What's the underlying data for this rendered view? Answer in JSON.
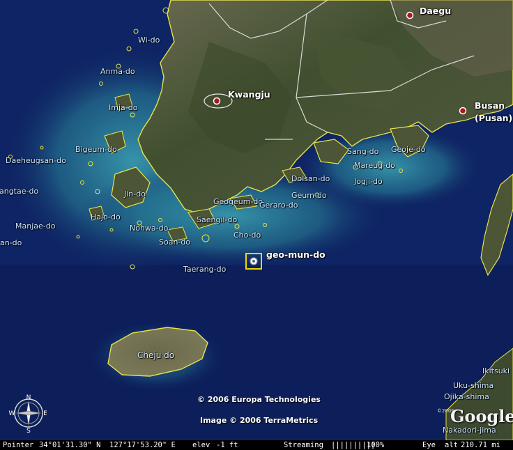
{
  "placemark": {
    "label": "geo-mun-do"
  },
  "cities": {
    "daegu": "Daegu",
    "kwangju": "Kwangju",
    "busan": "Busan",
    "pusan": "(Pusan)"
  },
  "islands": {
    "wi_do": "Wi-do",
    "anma_do": "Anma-do",
    "imja_do": "Imja-do",
    "bigeum_do": "Bigeum-do",
    "daeheugsan_do": "Daeheugsan-do",
    "sangtae_do": "Sangtae-do",
    "jin_do": "Jin-do",
    "hajo_do": "Hajo-do",
    "manjae_do": "Manjae-do",
    "an_do": "an-do",
    "nohwa_do": "Nohwa-do",
    "soan_do": "Soan-do",
    "saengil_do": "Saengil-do",
    "geogeum_do": "Geogeum-do",
    "geraro_do": "Geraro-do",
    "cho_do": "Cho-do",
    "geum_do": "Geum-do",
    "dolsan_do": "Dolsan-do",
    "sang_do": "Sang-do",
    "geoje_do": "Geoje-do",
    "mareug_do": "Mareug-do",
    "jogji_do": "Jogji-do",
    "taerang_do": "Taerang-do",
    "cheju_do": "Cheju do",
    "ikitsuki": "Ikitsuki",
    "uku_shima": "Uku-shima",
    "ojika_shima": "Ojika-shima",
    "nakadori_jima": "Nakadori-jima"
  },
  "credits": {
    "europa": "© 2006 Europa Technologies",
    "terrametrics": "Image © 2006 TerraMetrics",
    "logo": "Google",
    "logo_small": "©2006"
  },
  "status_bar": {
    "pointer_label": "Pointer",
    "pointer_lat": "34°01'31.30\" N",
    "pointer_lon": "127°17'53.20\" E",
    "elev_label": "elev",
    "elev_value": "-1 ft",
    "streaming_label": "Streaming",
    "streaming_bars": "||||||||||",
    "streaming_percent": "100%",
    "eye_label": "Eye",
    "alt_label": "alt",
    "alt_value": "210.71 mi"
  },
  "compass": {
    "n": "N",
    "s": "S",
    "e": "E",
    "w": "W"
  },
  "colors": {
    "ocean": "#0d1f5a",
    "shallow": "#2a7f9a",
    "coast": "#e7e34a",
    "land": "#4f5a3a",
    "border": "#e8e8e8",
    "placemark": "#f2d600",
    "city_dot": "#b01818"
  }
}
